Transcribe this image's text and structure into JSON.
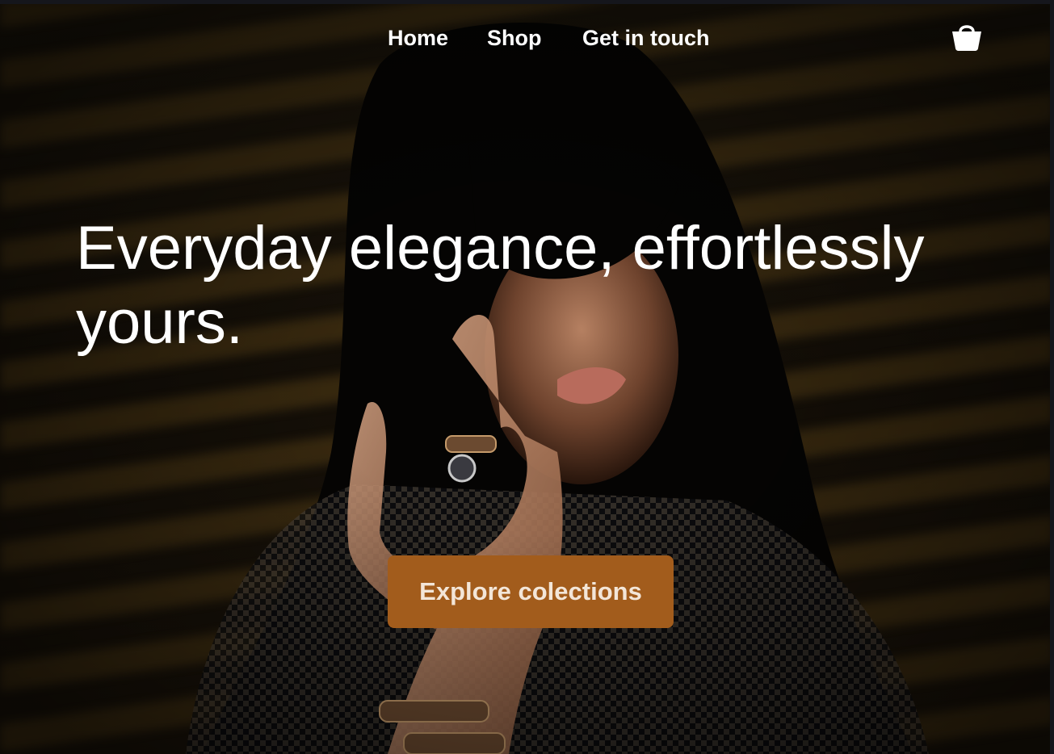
{
  "nav": {
    "links": [
      {
        "label": "Home"
      },
      {
        "label": "Shop"
      },
      {
        "label": "Get in touch"
      }
    ],
    "cart_icon": "shopping-bag-icon"
  },
  "hero": {
    "headline": "Everyday elegance, effortlessly yours.",
    "cta_label": "Explore colections",
    "background_image": "woman-with-rings-portrait"
  },
  "colors": {
    "accent": "#a25c1c",
    "text": "#ffffff",
    "background": "#130e07"
  }
}
